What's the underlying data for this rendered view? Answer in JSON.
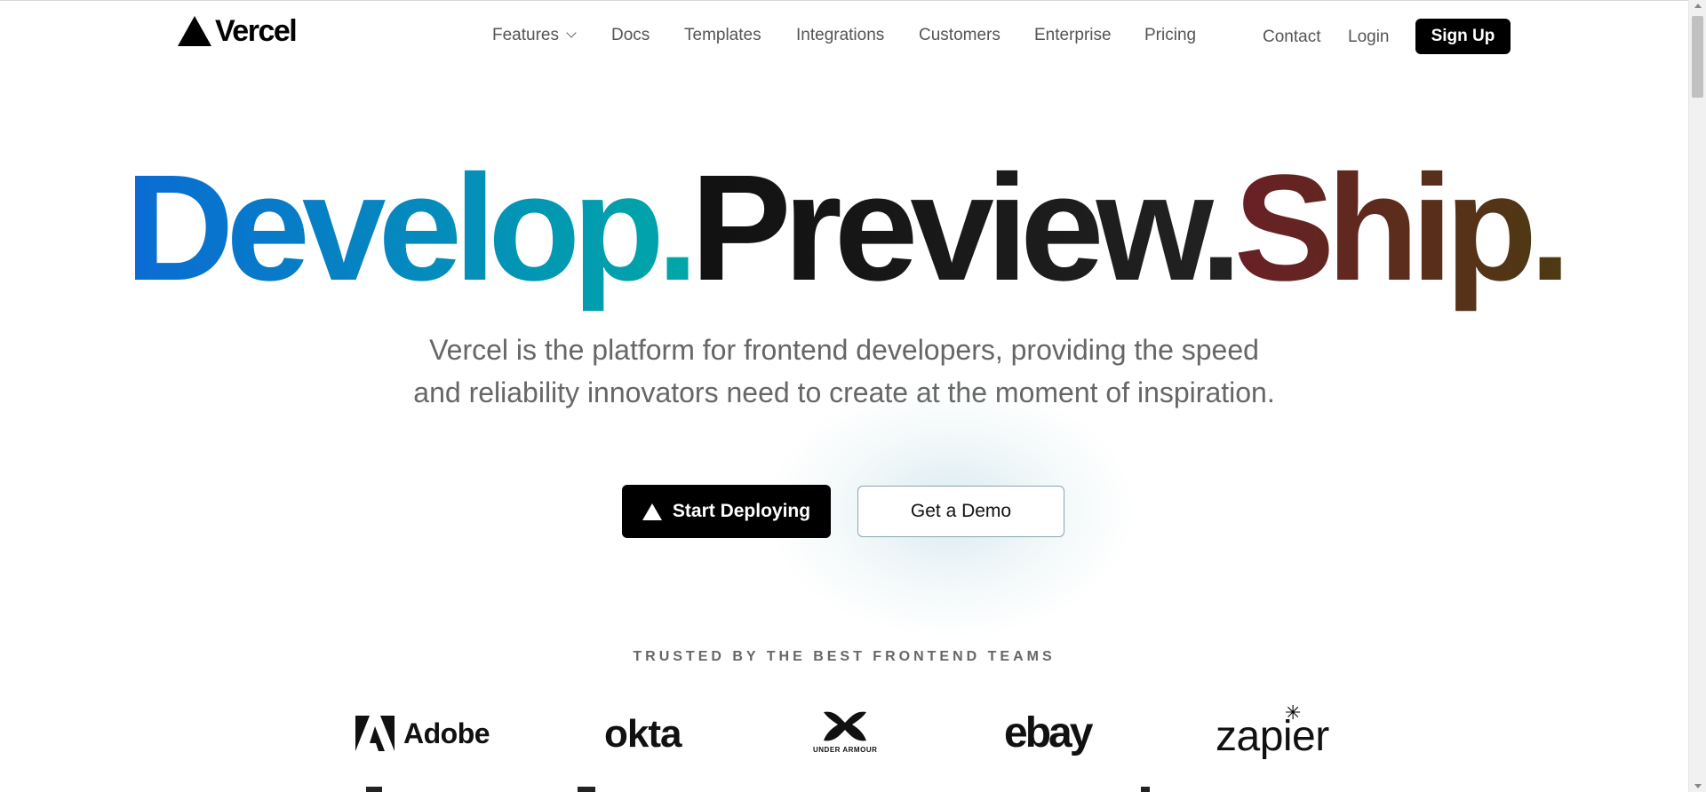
{
  "header": {
    "brand": "Vercel",
    "nav": [
      {
        "label": "Features",
        "has_dropdown": true
      },
      {
        "label": "Docs"
      },
      {
        "label": "Templates"
      },
      {
        "label": "Integrations"
      },
      {
        "label": "Customers"
      },
      {
        "label": "Enterprise"
      },
      {
        "label": "Pricing"
      }
    ],
    "contact": "Contact",
    "login": "Login",
    "signup": "Sign Up"
  },
  "hero": {
    "word1": "Develop.",
    "word2": "Preview.",
    "word3": "Ship.",
    "subtitle_line1": "Vercel is the platform for frontend developers, providing the speed",
    "subtitle_line2": "and reliability innovators need to create at the moment of inspiration.",
    "primary_cta": "Start Deploying",
    "secondary_cta": "Get a Demo"
  },
  "trusted": {
    "heading": "TRUSTED BY THE BEST FRONTEND TEAMS",
    "logos": [
      "Adobe",
      "okta",
      "UNDER ARMOUR",
      "ebay",
      "zapier"
    ]
  },
  "colors": {
    "develop_gradient": [
      "#0a6bd4",
      "#00a7a7"
    ],
    "preview": "#111111",
    "ship_gradient": [
      "#6a1f26",
      "#4d3a13"
    ],
    "primary_button": "#000000"
  },
  "icons": [
    "vercel-triangle-icon",
    "chevron-down-icon",
    "scroll-up-arrow-icon",
    "scroll-down-arrow-icon"
  ]
}
